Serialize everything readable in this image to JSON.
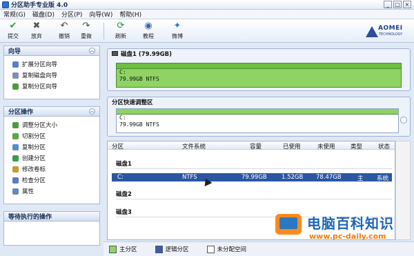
{
  "window": {
    "title": "分区助手专业版 4.0",
    "btn_min": "_",
    "btn_max": "□",
    "btn_close": "×"
  },
  "menu": [
    "常规(G)",
    "磁盘(D)",
    "分区(P)",
    "向导(W)",
    "帮助(H)"
  ],
  "toolbar": {
    "commit": "提交",
    "discard": "放弃",
    "undo": "撤销",
    "redo": "重做",
    "refresh": "刷新",
    "tutorial": "教程",
    "weibo": "微博"
  },
  "logo": {
    "name": "AOMEI",
    "sub": "TECHNOLOGY"
  },
  "wizard": {
    "title": "向导",
    "items": [
      "扩展分区向导",
      "复制磁盘向导",
      "复制分区向导"
    ]
  },
  "partition_ops": {
    "title": "分区操作",
    "items": [
      "调整分区大小",
      "切割分区",
      "复制分区",
      "创建分区",
      "修改卷标",
      "检查分区",
      "属性"
    ]
  },
  "pending": {
    "title": "等待执行的操作"
  },
  "disk_map": {
    "label": "磁盘1 (79.99GB)",
    "part_name": "C:",
    "part_info": "79.99GB NTFS"
  },
  "quick_resize": {
    "label": "分区快速调整区",
    "part_name": "C:",
    "part_info": "79.99GB NTFS"
  },
  "table": {
    "headers": [
      "分区",
      "文件系统",
      "容量",
      "已使用",
      "未使用",
      "类型",
      "状态"
    ],
    "groups": [
      "磁盘1",
      "磁盘2",
      "磁盘3"
    ],
    "row": [
      "C:",
      "NTFS",
      "79.99GB",
      "1.52GB",
      "78.47GB",
      "主",
      "系统"
    ]
  },
  "legend": [
    "主分区",
    "逻辑分区",
    "未分配空间"
  ],
  "colors": {
    "primary": "#8fd364",
    "logical": "#3a5fa8",
    "unallocated": "#ffffff",
    "selected_row": "#2b56a2"
  },
  "watermark": {
    "text": "电脑百科知识",
    "url": "www.pc-daily.com"
  }
}
